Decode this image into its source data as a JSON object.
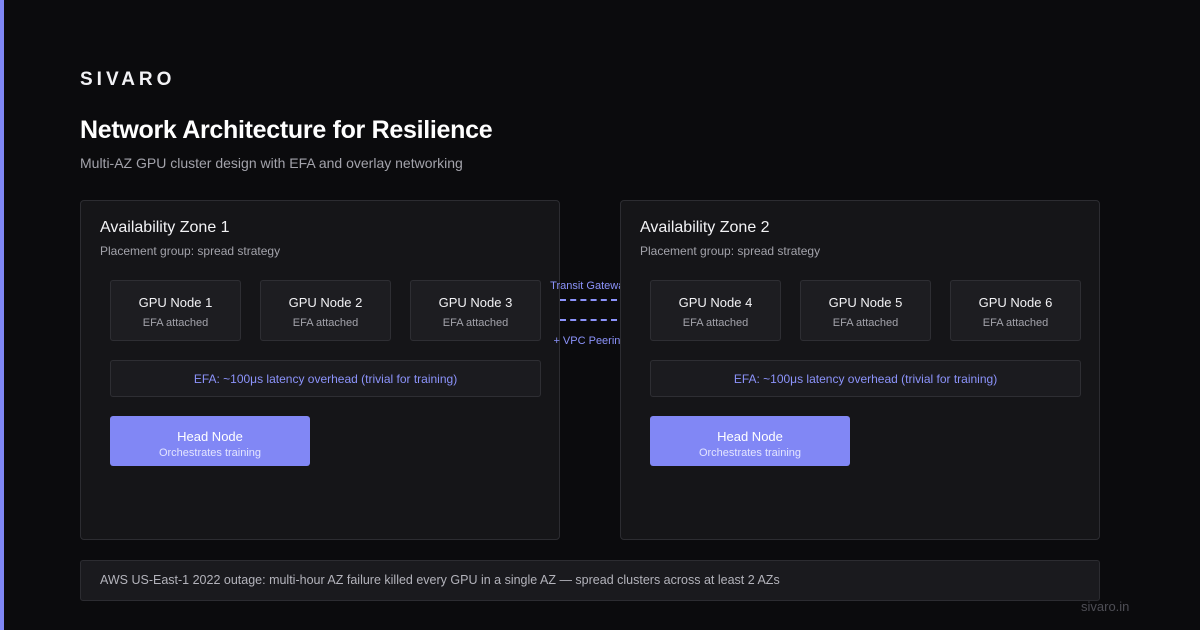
{
  "brand": "SIVARO",
  "title": "Network Architecture for Resilience",
  "subtitle": "Multi-AZ GPU cluster design with EFA and overlay networking",
  "colors": {
    "accent": "#7f86f5",
    "background": "#0b0b0d",
    "panel": "#151518",
    "link_text": "#8c93fb"
  },
  "zones": [
    {
      "title": "Availability Zone 1",
      "placement": "Placement group: spread strategy",
      "nodes": [
        {
          "name": "GPU Node 1",
          "status": "EFA attached"
        },
        {
          "name": "GPU Node 2",
          "status": "EFA attached"
        },
        {
          "name": "GPU Node 3",
          "status": "EFA attached"
        }
      ],
      "efa_note": "EFA: ~100μs latency overhead (trivial for training)",
      "head": {
        "title": "Head Node",
        "sub": "Orchestrates training"
      }
    },
    {
      "title": "Availability Zone 2",
      "placement": "Placement group: spread strategy",
      "nodes": [
        {
          "name": "GPU Node 4",
          "status": "EFA attached"
        },
        {
          "name": "GPU Node 5",
          "status": "EFA attached"
        },
        {
          "name": "GPU Node 6",
          "status": "EFA attached"
        }
      ],
      "efa_note": "EFA: ~100μs latency overhead (trivial for training)",
      "head": {
        "title": "Head Node",
        "sub": "Orchestrates training"
      }
    }
  ],
  "connection": {
    "top_label": "Transit Gateway",
    "bottom_label": "+ VPC Peering"
  },
  "footer": "AWS US-East-1 2022 outage: multi-hour AZ failure killed every GPU in a single AZ — spread clusters across at least 2 AZs",
  "domain": "sivaro.in"
}
